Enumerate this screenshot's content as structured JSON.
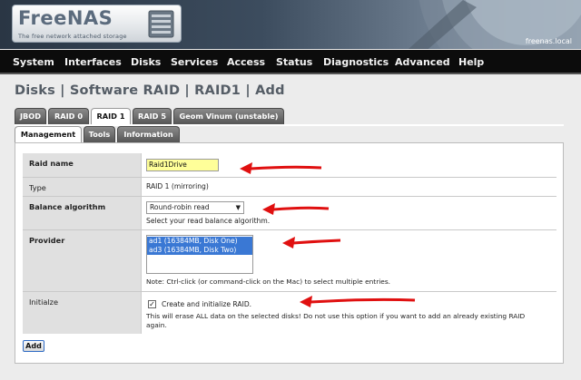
{
  "header": {
    "logo_title": "FreeNAS",
    "logo_tagline": "The free network attached storage",
    "hostname": "freenas.local"
  },
  "nav": [
    "System",
    "Interfaces",
    "Disks",
    "Services",
    "Access",
    "Status",
    "Diagnostics",
    "Advanced",
    "Help"
  ],
  "page_title": "Disks | Software RAID | RAID1 | Add",
  "tabs": [
    "JBOD",
    "RAID 0",
    "RAID 1",
    "RAID 5",
    "Geom Vinum (unstable)"
  ],
  "active_tab": "RAID 1",
  "subtabs": [
    "Management",
    "Tools",
    "Information"
  ],
  "active_subtab": "Management",
  "form": {
    "raid_name": {
      "label": "Raid name",
      "value": "Raid1Drive"
    },
    "type": {
      "label": "Type",
      "value": "RAID 1 (mirroring)"
    },
    "balance": {
      "label": "Balance algorithm",
      "selected": "Round-robin read",
      "hint": "Select your read balance algorithm."
    },
    "provider": {
      "label": "Provider",
      "options": [
        "ad1 (16384MB, Disk One)",
        "ad3 (16384MB, Disk Two)"
      ],
      "note": "Note: Ctrl-click (or command-click on the Mac) to select multiple entries."
    },
    "initialize": {
      "label": "Initialze",
      "checkbox_label": "Create and initialize RAID.",
      "checked": true,
      "checkmark": "✓",
      "note": "This will erase ALL data on the selected disks! Do not use this option if you want to add an already existing RAID again."
    },
    "add_label": "Add"
  },
  "colors": {
    "annotation_arrow": "#e01010",
    "selection": "#3a78d4",
    "name_field": "#ffff99"
  },
  "icons": [
    "server-logo-icon",
    "select-arrow-icon",
    "red-arrow-annotation"
  ]
}
